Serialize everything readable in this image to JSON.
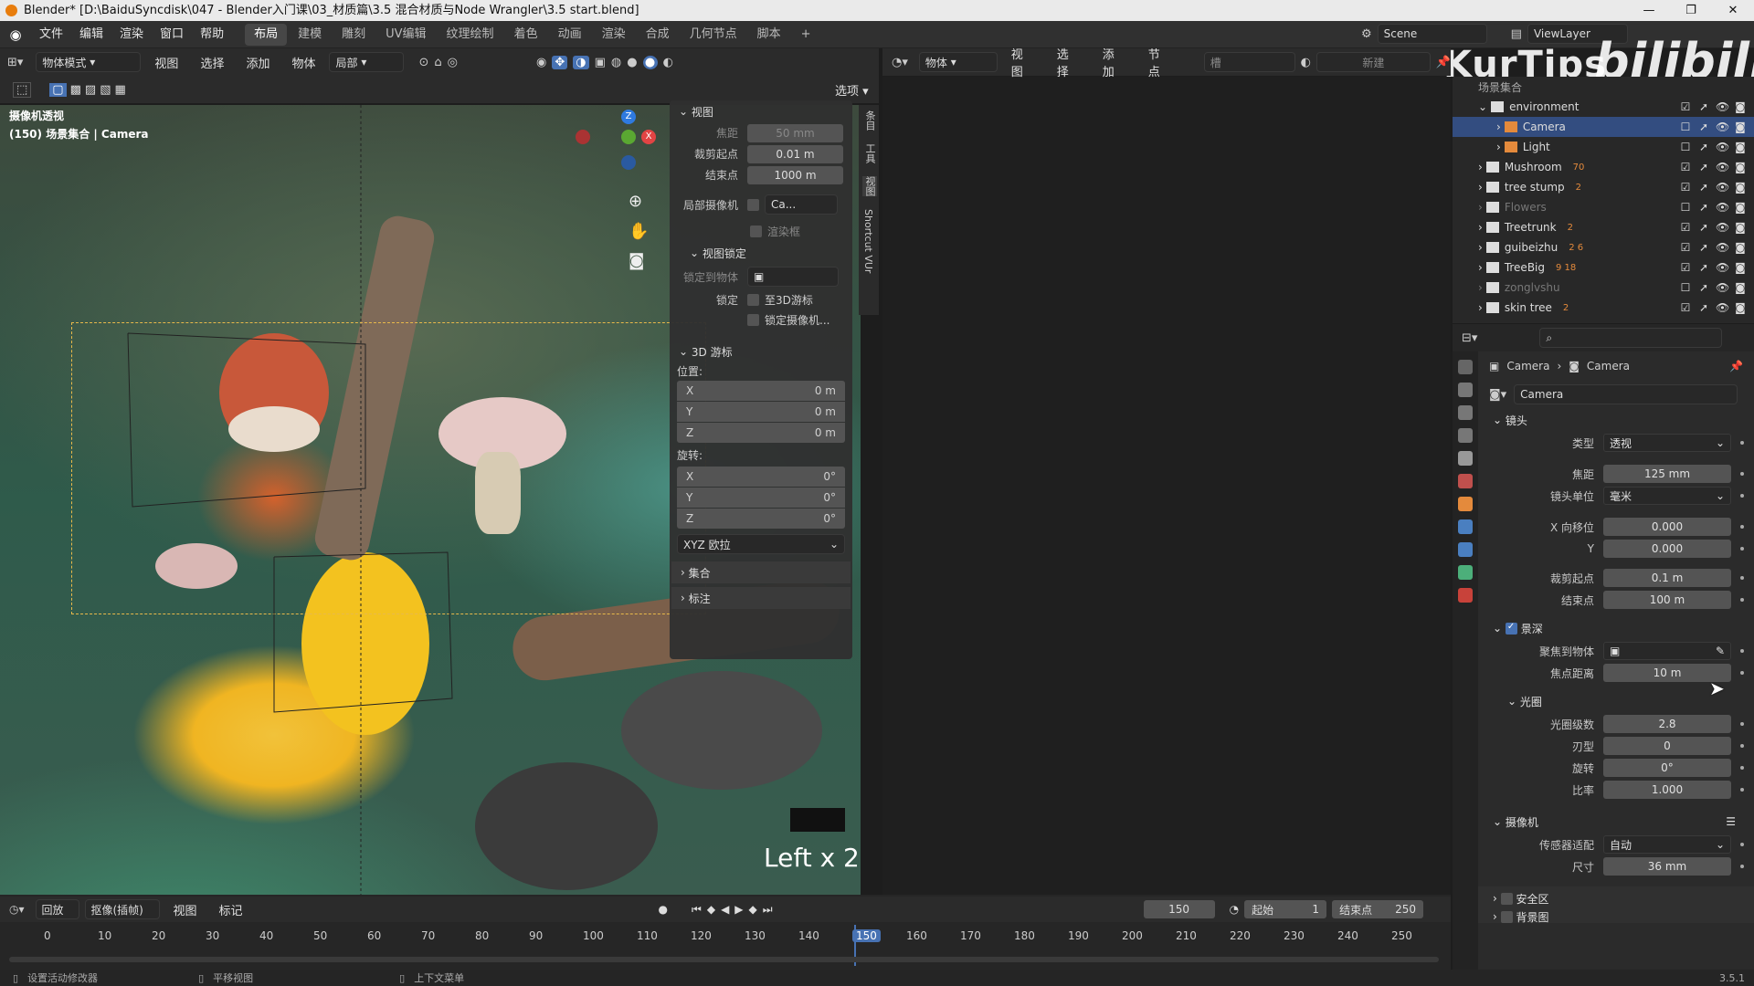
{
  "window": {
    "title": "Blender* [D:\\BaiduSyncdisk\\047 - Blender入门课\\03_材质篇\\3.5 混合材质与Node Wrangler\\3.5  start.blend]",
    "controls": [
      "—",
      "❐",
      "✕"
    ]
  },
  "menu": [
    "文件",
    "编辑",
    "渲染",
    "窗口",
    "帮助"
  ],
  "workspaces": [
    "布局",
    "建模",
    "雕刻",
    "UV编辑",
    "纹理绘制",
    "着色",
    "动画",
    "渲染",
    "合成",
    "几何节点",
    "脚本"
  ],
  "workspace_active": "布局",
  "scene": {
    "scene_name": "Scene",
    "view_layer": "ViewLayer"
  },
  "watermark": {
    "left": "KurTips",
    "right": "bilibili"
  },
  "viewport_header": {
    "mode": "物体模式",
    "items": [
      "视图",
      "选择",
      "添加",
      "物体"
    ],
    "transform": "局部",
    "options": "选项"
  },
  "viewport": {
    "overlay_title": "摄像机透视",
    "overlay_sub": "(150) 场景集合 | Camera",
    "key_hint": "Left x 2",
    "gizmo": {
      "z": "Z",
      "x": "X"
    }
  },
  "npanel": {
    "view_section": "视图",
    "focal_label": "焦距",
    "focal_value": "50 mm",
    "clip_start_label": "裁剪起点",
    "clip_start": "0.01 m",
    "clip_end_label": "结束点",
    "clip_end": "1000 m",
    "local_cam_label": "局部摄像机",
    "local_cam_value": "Ca...",
    "render_region": "渲染框",
    "lock_section": "视图锁定",
    "lock_object_label": "锁定到物体",
    "lock_label": "锁定",
    "lock_3d_cursor": "至3D游标",
    "lock_camera": "锁定摄像机...",
    "cursor_section": "3D 游标",
    "location_label": "位置:",
    "rotation_label": "旋转:",
    "loc": [
      {
        "axis": "X",
        "value": "0 m"
      },
      {
        "axis": "Y",
        "value": "0 m"
      },
      {
        "axis": "Z",
        "value": "0 m"
      }
    ],
    "rot": [
      {
        "axis": "X",
        "value": "0°"
      },
      {
        "axis": "Y",
        "value": "0°"
      },
      {
        "axis": "Z",
        "value": "0°"
      }
    ],
    "rot_mode": "XYZ 欧拉",
    "collection_section": "集合",
    "annotation_section": "标注",
    "tabs": [
      "条目",
      "工具",
      "视图",
      "Shortcut VUr"
    ]
  },
  "editor2_header": {
    "mode": "物体",
    "items": [
      "视图",
      "选择",
      "添加",
      "节点"
    ],
    "slot": "槽",
    "new": "新建"
  },
  "outliner": {
    "root": "场景集合",
    "rows": [
      {
        "name": "environment",
        "indent": 0,
        "checked": true
      },
      {
        "name": "Camera",
        "indent": 1,
        "checked": false,
        "selected": true
      },
      {
        "name": "Light",
        "indent": 1,
        "checked": false
      },
      {
        "name": "Mushroom",
        "indent": 0,
        "checked": true,
        "badge": "70"
      },
      {
        "name": "tree stump",
        "indent": 0,
        "checked": true,
        "badge": "2"
      },
      {
        "name": "Flowers",
        "indent": 0,
        "checked": false,
        "dim": true
      },
      {
        "name": "Treetrunk",
        "indent": 0,
        "checked": true,
        "badge": "2"
      },
      {
        "name": "guibeizhu",
        "indent": 0,
        "checked": true,
        "badge": "2 6"
      },
      {
        "name": "TreeBig",
        "indent": 0,
        "checked": true,
        "badge": "9 18"
      },
      {
        "name": "zonglvshu",
        "indent": 0,
        "checked": false,
        "dim": true
      },
      {
        "name": "skin tree",
        "indent": 0,
        "checked": true,
        "badge": "2"
      }
    ]
  },
  "properties": {
    "breadcrumb": [
      "Camera",
      "Camera"
    ],
    "data_name": "Camera",
    "lens_section": "镜头",
    "type_label": "类型",
    "type_value": "透视",
    "focal_label": "焦距",
    "focal_value": "125 mm",
    "unit_label": "镜头单位",
    "unit_value": "毫米",
    "shift_x_label": "X 向移位",
    "shift_x": "0.000",
    "shift_y_label": "Y",
    "shift_y": "0.000",
    "clip_start_label": "裁剪起点",
    "clip_start": "0.1 m",
    "clip_end_label": "结束点",
    "clip_end": "100 m",
    "dof_section": "景深",
    "focus_obj_label": "聚焦到物体",
    "focus_dist_label": "焦点距离",
    "focus_dist": "10 m",
    "aperture_section": "光圈",
    "fstop_label": "光圈级数",
    "fstop": "2.8",
    "blades_label": "刃型",
    "blades": "0",
    "rotation_label": "旋转",
    "rotation": "0°",
    "ratio_label": "比率",
    "ratio": "1.000",
    "camera_section": "摄像机",
    "sensor_fit_label": "传感器适配",
    "sensor_fit": "自动",
    "size_label": "尺寸",
    "size": "36 mm",
    "safe_section": "安全区",
    "bg_section": "背景图"
  },
  "timeline": {
    "playback": "回放",
    "keying": "抠像(插帧)",
    "view": "视图",
    "marker": "标记",
    "current_frame": "150",
    "start_label": "起始",
    "start": "1",
    "end_label": "结束点",
    "end": "250",
    "ticks": [
      "0",
      "10",
      "20",
      "30",
      "40",
      "50",
      "60",
      "70",
      "80",
      "90",
      "100",
      "110",
      "120",
      "130",
      "140",
      "150",
      "160",
      "170",
      "180",
      "190",
      "200",
      "210",
      "220",
      "230",
      "240",
      "250"
    ]
  },
  "status": {
    "left": "设置活动修改器",
    "middle": "平移视图",
    "right": "上下文菜单",
    "version": "3.5.1"
  }
}
